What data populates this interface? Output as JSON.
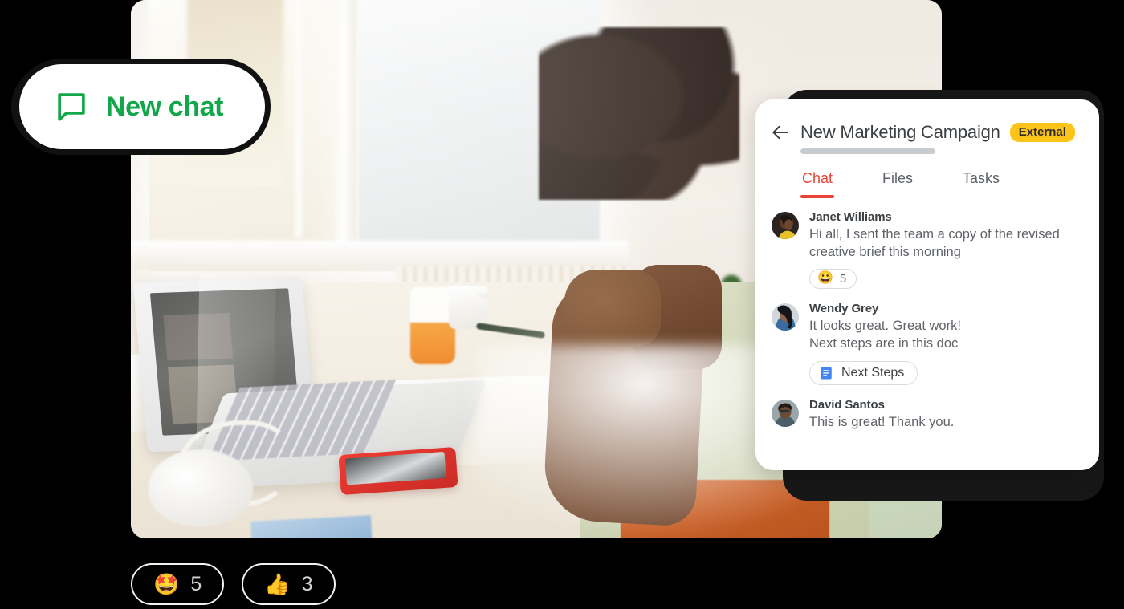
{
  "new_chat_button": {
    "label": "New chat",
    "icon": "chat-bubble-icon",
    "accent_color": "#12a64a",
    "background": "#ffffff"
  },
  "photo": {
    "alt": "Person sitting at a sunlit desk with a laptop during a video call",
    "icon": "workspace-photo"
  },
  "chat_panel": {
    "back_icon": "back-arrow-icon",
    "title": "New Marketing Campaign",
    "badge": {
      "label": "External",
      "color": "#fcc419"
    },
    "tabs": [
      {
        "label": "Chat",
        "active": true
      },
      {
        "label": "Files",
        "active": false
      },
      {
        "label": "Tasks",
        "active": false
      }
    ],
    "active_tab_color": "#ea4335",
    "messages": [
      {
        "author": "Janet Williams",
        "avatar": "avatar-janet",
        "text": "Hi all, I sent the team a copy of the revised creative brief this morning",
        "reaction": {
          "emoji": "😀",
          "name": "grinning-face-emoji",
          "count": "5"
        }
      },
      {
        "author": "Wendy Grey",
        "avatar": "avatar-wendy",
        "text": "It looks great. Great work!\nNext steps are in this doc",
        "attachment": {
          "label": "Next Steps",
          "icon": "google-docs-icon",
          "color": "#4285f4"
        }
      },
      {
        "author": "David Santos",
        "avatar": "avatar-david",
        "text": "This is great! Thank you."
      }
    ]
  },
  "bottom_reactions": [
    {
      "emoji": "🤩",
      "name": "star-struck-emoji",
      "count": "5"
    },
    {
      "emoji": "👍",
      "name": "thumbs-up-emoji",
      "count": "3"
    }
  ]
}
